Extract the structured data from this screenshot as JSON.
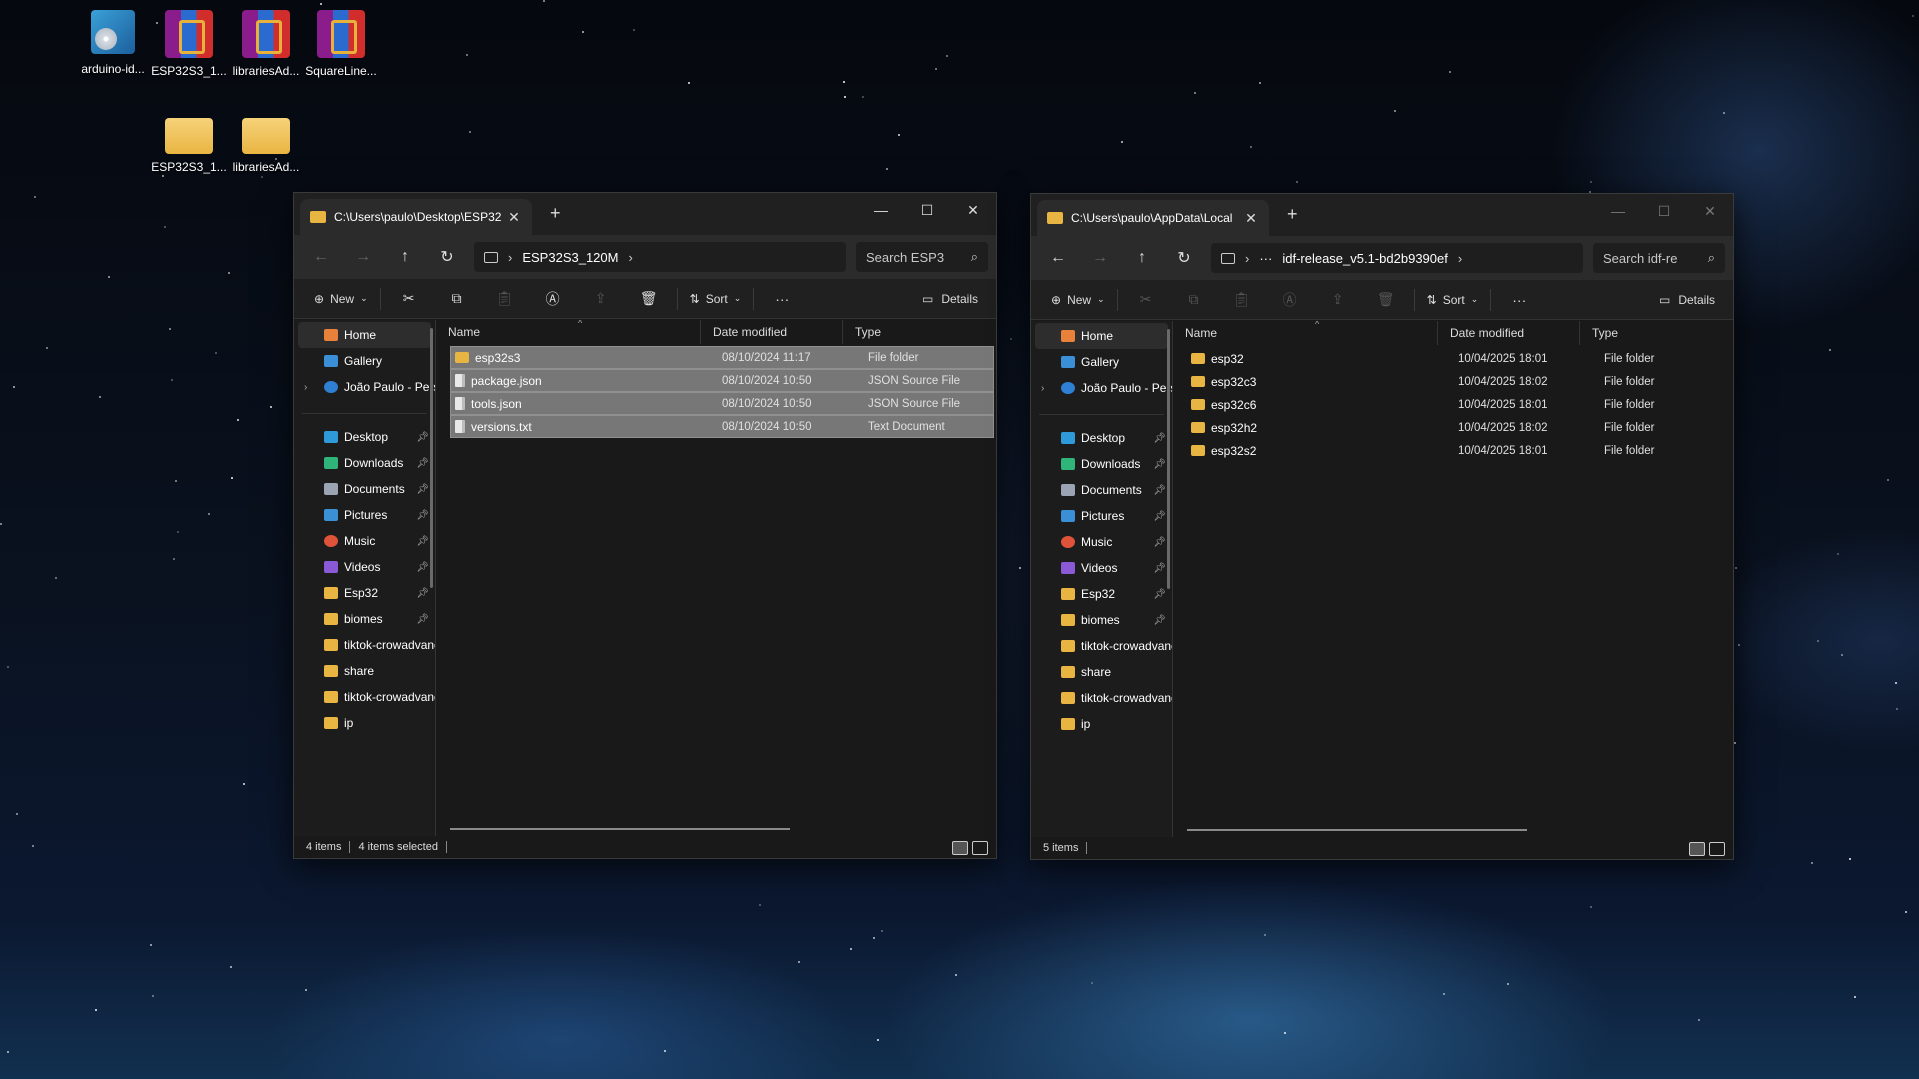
{
  "desktop": {
    "icons": [
      {
        "label": "arduino-id...",
        "icon": "installer-disc-icon"
      },
      {
        "label": "ESP32S3_1...",
        "icon": "winrar-archive-icon"
      },
      {
        "label": "librariesAd...",
        "icon": "winrar-archive-icon"
      },
      {
        "label": "SquareLine...",
        "icon": "winrar-archive-icon"
      },
      {
        "label": "ESP32S3_1...",
        "icon": "folder-icon"
      },
      {
        "label": "librariesAd...",
        "icon": "folder-icon"
      }
    ]
  },
  "left_window": {
    "tab_title": "C:\\Users\\paulo\\Desktop\\ESP32",
    "breadcrumb": [
      "ESP32S3_120M"
    ],
    "search_placeholder": "Search ESP3",
    "commands": {
      "new": "New",
      "sort": "Sort",
      "more": "···",
      "details": "Details"
    },
    "columns": [
      "Name",
      "Date modified",
      "Type"
    ],
    "files": [
      {
        "name": "esp32s3",
        "date": "08/10/2024 11:17",
        "type": "File folder",
        "kind": "folder"
      },
      {
        "name": "package.json",
        "date": "08/10/2024 10:50",
        "type": "JSON Source File",
        "kind": "file"
      },
      {
        "name": "tools.json",
        "date": "08/10/2024 10:50",
        "type": "JSON Source File",
        "kind": "file"
      },
      {
        "name": "versions.txt",
        "date": "08/10/2024 10:50",
        "type": "Text Document",
        "kind": "file"
      }
    ],
    "status": {
      "items": "4 items",
      "selected": "4 items selected"
    }
  },
  "right_window": {
    "tab_title": "C:\\Users\\paulo\\AppData\\Local",
    "breadcrumb_ellipsis": "···",
    "breadcrumb": [
      "idf-release_v5.1-bd2b9390ef"
    ],
    "search_placeholder": "Search idf-re",
    "commands": {
      "new": "New",
      "sort": "Sort",
      "more": "···",
      "details": "Details"
    },
    "columns": [
      "Name",
      "Date modified",
      "Type"
    ],
    "files": [
      {
        "name": "esp32",
        "date": "10/04/2025 18:01",
        "type": "File folder",
        "kind": "folder"
      },
      {
        "name": "esp32c3",
        "date": "10/04/2025 18:02",
        "type": "File folder",
        "kind": "folder"
      },
      {
        "name": "esp32c6",
        "date": "10/04/2025 18:01",
        "type": "File folder",
        "kind": "folder"
      },
      {
        "name": "esp32h2",
        "date": "10/04/2025 18:02",
        "type": "File folder",
        "kind": "folder"
      },
      {
        "name": "esp32s2",
        "date": "10/04/2025 18:01",
        "type": "File folder",
        "kind": "folder"
      }
    ],
    "status": {
      "items": "5 items"
    }
  },
  "sidebar": {
    "top": [
      {
        "label": "Home",
        "icon": "home-icon",
        "color": "#e8813a"
      },
      {
        "label": "Gallery",
        "icon": "gallery-icon",
        "color": "#3a8fd6"
      },
      {
        "label": "João Paulo - Persoı",
        "icon": "onedrive-icon",
        "color": "#2f7fd4"
      }
    ],
    "pinned": [
      {
        "label": "Desktop",
        "icon": "desktop-icon",
        "color": "#2f9ad9",
        "pinned": true
      },
      {
        "label": "Downloads",
        "icon": "downloads-icon",
        "color": "#2fb57a",
        "pinned": true
      },
      {
        "label": "Documents",
        "icon": "documents-icon",
        "color": "#9aa4b2",
        "pinned": true
      },
      {
        "label": "Pictures",
        "icon": "pictures-icon",
        "color": "#3a8fd6",
        "pinned": true
      },
      {
        "label": "Music",
        "icon": "music-icon",
        "color": "#e0533b",
        "pinned": true
      },
      {
        "label": "Videos",
        "icon": "videos-icon",
        "color": "#8a5ad6",
        "pinned": true
      },
      {
        "label": "Esp32",
        "icon": "folder-icon",
        "color": "#e9b542",
        "pinned": true
      },
      {
        "label": "biomes",
        "icon": "folder-icon",
        "color": "#e9b542",
        "pinned": true
      },
      {
        "label": "tiktok-crowadvanc",
        "icon": "folder-icon",
        "color": "#e9b542",
        "pinned": false
      },
      {
        "label": "share",
        "icon": "folder-icon",
        "color": "#e9b542",
        "pinned": false
      },
      {
        "label": "tiktok-crowadvanc",
        "icon": "folder-icon",
        "color": "#e9b542",
        "pinned": false
      },
      {
        "label": "ip",
        "icon": "folder-icon",
        "color": "#e9b542",
        "pinned": false
      }
    ]
  }
}
